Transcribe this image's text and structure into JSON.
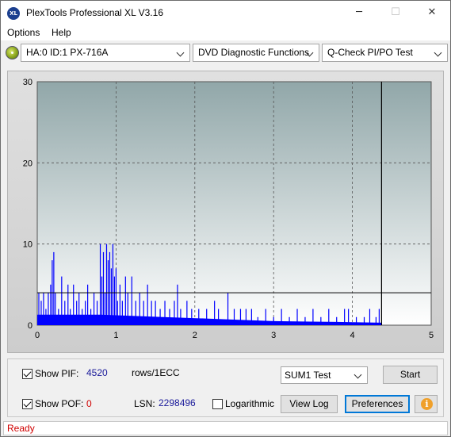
{
  "window": {
    "title": "PlexTools Professional XL V3.16",
    "icon_text": "XL",
    "minimize_glyph": "─",
    "maximize_glyph": "☐",
    "close_glyph": "✕"
  },
  "menu": {
    "options": "Options",
    "help": "Help"
  },
  "toolbar": {
    "drive": "HA:0 ID:1  PX-716A",
    "function": "DVD Diagnostic Functions",
    "test": "Q-Check PI/PO Test"
  },
  "chart_data": {
    "type": "bar",
    "xlim": [
      0,
      5
    ],
    "ylim": [
      0,
      30
    ],
    "xticks": [
      "0",
      "1",
      "2",
      "3",
      "4",
      "5"
    ],
    "yticks": [
      "0",
      "10",
      "20",
      "30"
    ],
    "grid": true,
    "marker_x": 4.37,
    "threshold_y": 4,
    "series_color": "#0000ff",
    "background_top": "#91a7a9",
    "background_bottom": "#ffffff",
    "spikes": [
      [
        0.02,
        4
      ],
      [
        0.05,
        3
      ],
      [
        0.08,
        4
      ],
      [
        0.11,
        2
      ],
      [
        0.14,
        4
      ],
      [
        0.17,
        5
      ],
      [
        0.19,
        8
      ],
      [
        0.21,
        9
      ],
      [
        0.23,
        4
      ],
      [
        0.27,
        2
      ],
      [
        0.31,
        6
      ],
      [
        0.35,
        3
      ],
      [
        0.39,
        5
      ],
      [
        0.42,
        2
      ],
      [
        0.46,
        5
      ],
      [
        0.5,
        3
      ],
      [
        0.53,
        4
      ],
      [
        0.57,
        2
      ],
      [
        0.61,
        3
      ],
      [
        0.64,
        5
      ],
      [
        0.68,
        2
      ],
      [
        0.72,
        4
      ],
      [
        0.76,
        3
      ],
      [
        0.8,
        10
      ],
      [
        0.82,
        6
      ],
      [
        0.84,
        9
      ],
      [
        0.86,
        4
      ],
      [
        0.88,
        10
      ],
      [
        0.9,
        8
      ],
      [
        0.92,
        9
      ],
      [
        0.94,
        7
      ],
      [
        0.96,
        10
      ],
      [
        0.98,
        6
      ],
      [
        1.0,
        7
      ],
      [
        1.02,
        3
      ],
      [
        1.05,
        5
      ],
      [
        1.08,
        3
      ],
      [
        1.12,
        6
      ],
      [
        1.15,
        4
      ],
      [
        1.2,
        6
      ],
      [
        1.25,
        3
      ],
      [
        1.3,
        4
      ],
      [
        1.35,
        3
      ],
      [
        1.4,
        5
      ],
      [
        1.45,
        3
      ],
      [
        1.5,
        3
      ],
      [
        1.56,
        2
      ],
      [
        1.62,
        3
      ],
      [
        1.68,
        2
      ],
      [
        1.74,
        3
      ],
      [
        1.78,
        5
      ],
      [
        1.82,
        2
      ],
      [
        1.9,
        3
      ],
      [
        1.96,
        2
      ],
      [
        2.05,
        2
      ],
      [
        2.15,
        2
      ],
      [
        2.25,
        3
      ],
      [
        2.3,
        2
      ],
      [
        2.42,
        4
      ],
      [
        2.5,
        2
      ],
      [
        2.58,
        2
      ],
      [
        2.65,
        2
      ],
      [
        2.72,
        2
      ],
      [
        2.8,
        1
      ],
      [
        2.9,
        2
      ],
      [
        3.0,
        1
      ],
      [
        3.1,
        2
      ],
      [
        3.2,
        1
      ],
      [
        3.3,
        2
      ],
      [
        3.4,
        1
      ],
      [
        3.5,
        2
      ],
      [
        3.6,
        1
      ],
      [
        3.7,
        2
      ],
      [
        3.8,
        1
      ],
      [
        3.9,
        2
      ],
      [
        3.95,
        2
      ],
      [
        4.05,
        1
      ],
      [
        4.15,
        1
      ],
      [
        4.22,
        2
      ],
      [
        4.3,
        1
      ],
      [
        4.34,
        2
      ]
    ],
    "baseline": [
      [
        0.0,
        1.3
      ],
      [
        0.8,
        1.3
      ],
      [
        1.6,
        1.0
      ],
      [
        2.2,
        0.8
      ],
      [
        3.0,
        0.5
      ],
      [
        3.8,
        0.4
      ],
      [
        4.37,
        0.3
      ]
    ]
  },
  "controls": {
    "show_pif_label": "Show PIF:",
    "pif_value": "4520",
    "pif_unit": "rows/1ECC",
    "show_pof_label": "Show POF:",
    "pof_value": "0",
    "lsn_label": "LSN:",
    "lsn_value": "2298496",
    "logarithmic_label": "Logarithmic",
    "sum_test": "SUM1 Test",
    "start": "Start",
    "view_log": "View Log",
    "preferences": "Preferences",
    "info_glyph": "i"
  },
  "status": {
    "text": "Ready"
  }
}
